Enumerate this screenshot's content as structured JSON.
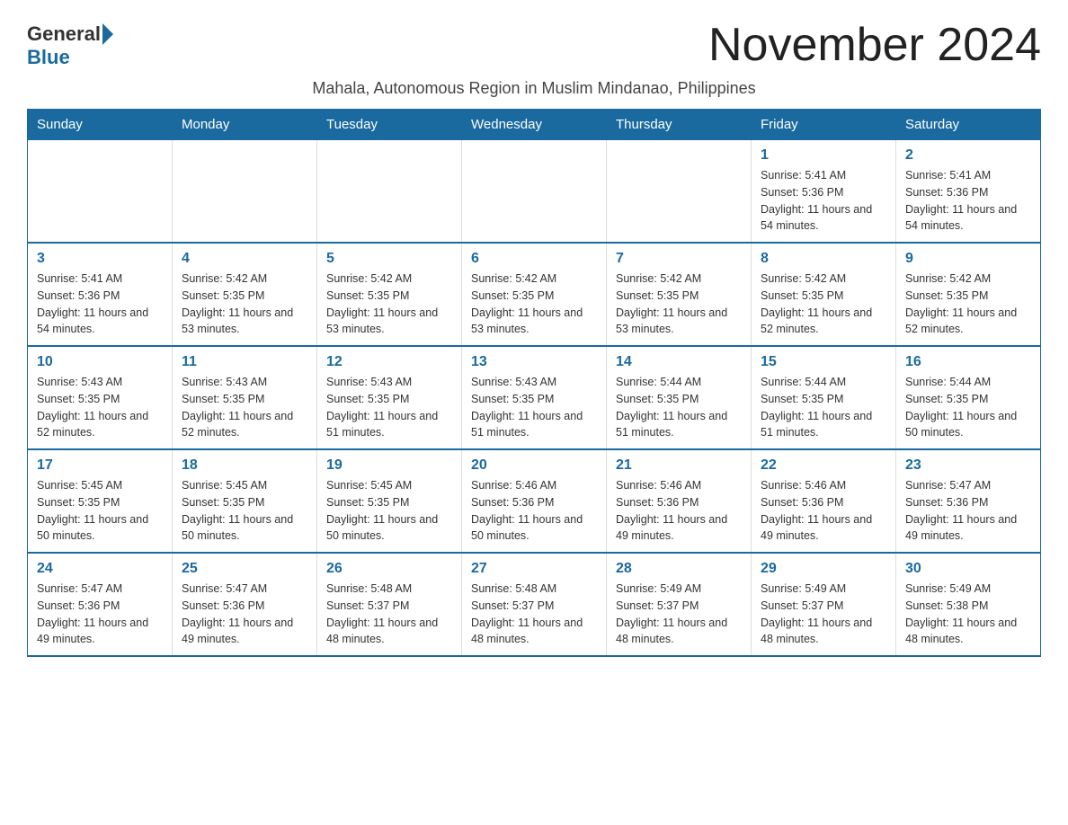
{
  "header": {
    "logo_general": "General",
    "logo_blue": "Blue",
    "month_title": "November 2024",
    "subtitle": "Mahala, Autonomous Region in Muslim Mindanao, Philippines"
  },
  "days_of_week": [
    "Sunday",
    "Monday",
    "Tuesday",
    "Wednesday",
    "Thursday",
    "Friday",
    "Saturday"
  ],
  "weeks": [
    [
      {
        "day": "",
        "info": ""
      },
      {
        "day": "",
        "info": ""
      },
      {
        "day": "",
        "info": ""
      },
      {
        "day": "",
        "info": ""
      },
      {
        "day": "",
        "info": ""
      },
      {
        "day": "1",
        "info": "Sunrise: 5:41 AM\nSunset: 5:36 PM\nDaylight: 11 hours and 54 minutes."
      },
      {
        "day": "2",
        "info": "Sunrise: 5:41 AM\nSunset: 5:36 PM\nDaylight: 11 hours and 54 minutes."
      }
    ],
    [
      {
        "day": "3",
        "info": "Sunrise: 5:41 AM\nSunset: 5:36 PM\nDaylight: 11 hours and 54 minutes."
      },
      {
        "day": "4",
        "info": "Sunrise: 5:42 AM\nSunset: 5:35 PM\nDaylight: 11 hours and 53 minutes."
      },
      {
        "day": "5",
        "info": "Sunrise: 5:42 AM\nSunset: 5:35 PM\nDaylight: 11 hours and 53 minutes."
      },
      {
        "day": "6",
        "info": "Sunrise: 5:42 AM\nSunset: 5:35 PM\nDaylight: 11 hours and 53 minutes."
      },
      {
        "day": "7",
        "info": "Sunrise: 5:42 AM\nSunset: 5:35 PM\nDaylight: 11 hours and 53 minutes."
      },
      {
        "day": "8",
        "info": "Sunrise: 5:42 AM\nSunset: 5:35 PM\nDaylight: 11 hours and 52 minutes."
      },
      {
        "day": "9",
        "info": "Sunrise: 5:42 AM\nSunset: 5:35 PM\nDaylight: 11 hours and 52 minutes."
      }
    ],
    [
      {
        "day": "10",
        "info": "Sunrise: 5:43 AM\nSunset: 5:35 PM\nDaylight: 11 hours and 52 minutes."
      },
      {
        "day": "11",
        "info": "Sunrise: 5:43 AM\nSunset: 5:35 PM\nDaylight: 11 hours and 52 minutes."
      },
      {
        "day": "12",
        "info": "Sunrise: 5:43 AM\nSunset: 5:35 PM\nDaylight: 11 hours and 51 minutes."
      },
      {
        "day": "13",
        "info": "Sunrise: 5:43 AM\nSunset: 5:35 PM\nDaylight: 11 hours and 51 minutes."
      },
      {
        "day": "14",
        "info": "Sunrise: 5:44 AM\nSunset: 5:35 PM\nDaylight: 11 hours and 51 minutes."
      },
      {
        "day": "15",
        "info": "Sunrise: 5:44 AM\nSunset: 5:35 PM\nDaylight: 11 hours and 51 minutes."
      },
      {
        "day": "16",
        "info": "Sunrise: 5:44 AM\nSunset: 5:35 PM\nDaylight: 11 hours and 50 minutes."
      }
    ],
    [
      {
        "day": "17",
        "info": "Sunrise: 5:45 AM\nSunset: 5:35 PM\nDaylight: 11 hours and 50 minutes."
      },
      {
        "day": "18",
        "info": "Sunrise: 5:45 AM\nSunset: 5:35 PM\nDaylight: 11 hours and 50 minutes."
      },
      {
        "day": "19",
        "info": "Sunrise: 5:45 AM\nSunset: 5:35 PM\nDaylight: 11 hours and 50 minutes."
      },
      {
        "day": "20",
        "info": "Sunrise: 5:46 AM\nSunset: 5:36 PM\nDaylight: 11 hours and 50 minutes."
      },
      {
        "day": "21",
        "info": "Sunrise: 5:46 AM\nSunset: 5:36 PM\nDaylight: 11 hours and 49 minutes."
      },
      {
        "day": "22",
        "info": "Sunrise: 5:46 AM\nSunset: 5:36 PM\nDaylight: 11 hours and 49 minutes."
      },
      {
        "day": "23",
        "info": "Sunrise: 5:47 AM\nSunset: 5:36 PM\nDaylight: 11 hours and 49 minutes."
      }
    ],
    [
      {
        "day": "24",
        "info": "Sunrise: 5:47 AM\nSunset: 5:36 PM\nDaylight: 11 hours and 49 minutes."
      },
      {
        "day": "25",
        "info": "Sunrise: 5:47 AM\nSunset: 5:36 PM\nDaylight: 11 hours and 49 minutes."
      },
      {
        "day": "26",
        "info": "Sunrise: 5:48 AM\nSunset: 5:37 PM\nDaylight: 11 hours and 48 minutes."
      },
      {
        "day": "27",
        "info": "Sunrise: 5:48 AM\nSunset: 5:37 PM\nDaylight: 11 hours and 48 minutes."
      },
      {
        "day": "28",
        "info": "Sunrise: 5:49 AM\nSunset: 5:37 PM\nDaylight: 11 hours and 48 minutes."
      },
      {
        "day": "29",
        "info": "Sunrise: 5:49 AM\nSunset: 5:37 PM\nDaylight: 11 hours and 48 minutes."
      },
      {
        "day": "30",
        "info": "Sunrise: 5:49 AM\nSunset: 5:38 PM\nDaylight: 11 hours and 48 minutes."
      }
    ]
  ]
}
